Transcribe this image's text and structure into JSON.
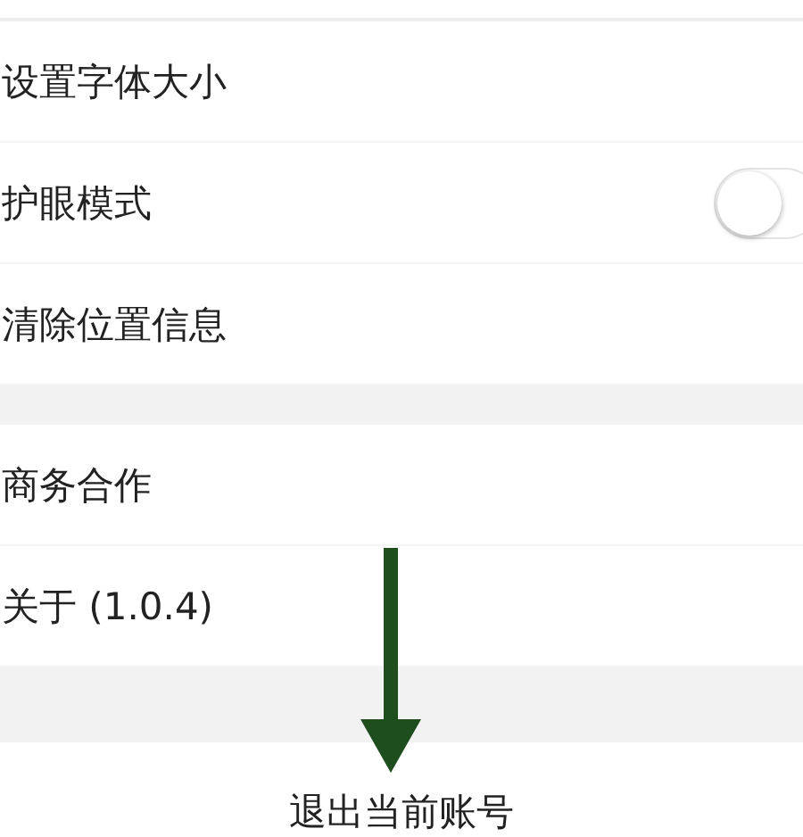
{
  "groups": [
    {
      "items": [
        {
          "kind": "link",
          "label": "设置字体大小"
        },
        {
          "kind": "toggle",
          "label": "护眼模式",
          "on": false
        },
        {
          "kind": "link",
          "label": "清除位置信息"
        }
      ]
    },
    {
      "items": [
        {
          "kind": "link",
          "label": "商务合作"
        },
        {
          "kind": "link",
          "label": "关于 (1.0.4)"
        }
      ]
    }
  ],
  "logout": {
    "label": "退出当前账号"
  }
}
